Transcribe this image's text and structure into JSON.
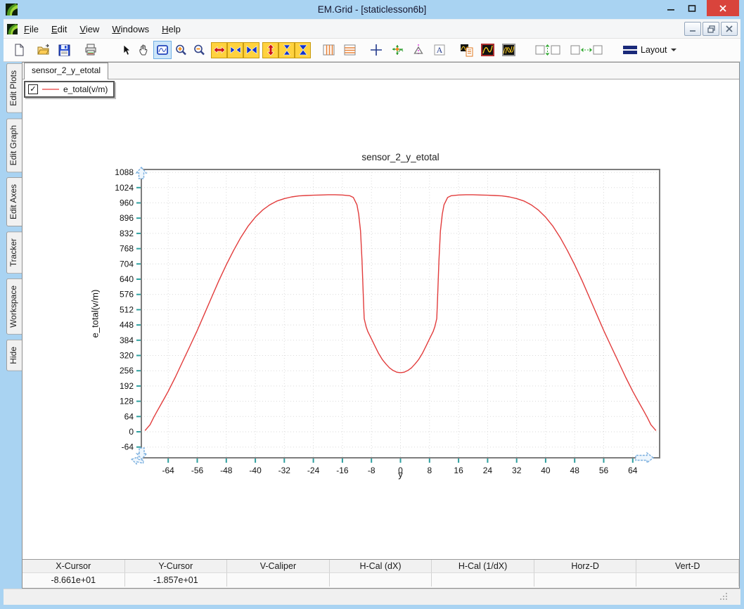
{
  "window": {
    "title": "EM.Grid - [staticlesson6b]",
    "controls": [
      "minimize",
      "maximize",
      "close"
    ]
  },
  "menu": {
    "items": [
      {
        "first": "F",
        "rest": "ile"
      },
      {
        "first": "E",
        "rest": "dit"
      },
      {
        "first": "V",
        "rest": "iew"
      },
      {
        "first": "W",
        "rest": "indows"
      },
      {
        "first": "H",
        "rest": "elp"
      }
    ]
  },
  "toolbar": {
    "layout_label": "Layout",
    "active_tool": "zoom-box",
    "icons": [
      "new-document",
      "open",
      "save",
      "print",
      "select-pointer",
      "pan-hand",
      "zoom-box",
      "zoom-in",
      "zoom-out",
      "expand-x",
      "shrink-x",
      "fit-x",
      "expand-y",
      "shrink-y",
      "fit-y",
      "vertical-gridlines",
      "horizontal-gridlines",
      "crosshair-cursor",
      "tracker-cursor",
      "caliper",
      "text-annotation",
      "plot-properties",
      "single-plot",
      "multi-plot",
      "align-vertical",
      "align-horizontal",
      "layout-menu"
    ]
  },
  "sidebar": {
    "tabs": [
      "Edit Plots",
      "Edit Graph",
      "Edit Axes",
      "Tracker",
      "Workspace",
      "Hide"
    ]
  },
  "doc": {
    "tab": "sensor_2_y_etotal"
  },
  "legend": {
    "checked": true,
    "check_glyph": "✓",
    "label": "e_total(v/m)",
    "line_color": "#f08585"
  },
  "statusbar": {
    "cols": [
      {
        "label": "X-Cursor",
        "value": "-8.661e+01"
      },
      {
        "label": "Y-Cursor",
        "value": "-1.857e+01"
      },
      {
        "label": "V-Caliper",
        "value": ""
      },
      {
        "label": "H-Cal (dX)",
        "value": ""
      },
      {
        "label": "H-Cal (1/dX)",
        "value": ""
      },
      {
        "label": "Horz-D",
        "value": ""
      },
      {
        "label": "Vert-D",
        "value": ""
      }
    ]
  },
  "colors": {
    "frame_blue": "#a9d3f2",
    "close_red": "#d9443c",
    "curve_red": "#e23c3c",
    "tick_teal": "#2f9f9f",
    "handle_blue": "#79aede"
  },
  "chart_data": {
    "type": "line",
    "title": "sensor_2_y_etotal",
    "xlabel": "y",
    "ylabel": "e_total(v/m)",
    "xlim": [
      -71.4,
      71.4
    ],
    "ylim": [
      -109,
      1100
    ],
    "x_ticks": [
      -64,
      -56,
      -48,
      -40,
      -32,
      -24,
      -16,
      -8,
      0,
      8,
      16,
      24,
      32,
      40,
      48,
      56,
      64
    ],
    "y_ticks": [
      -64,
      0,
      64,
      128,
      192,
      256,
      320,
      384,
      448,
      512,
      576,
      640,
      704,
      768,
      832,
      896,
      960,
      1024,
      1088
    ],
    "grid": true,
    "legend_position": "top-left-overlay",
    "series": [
      {
        "name": "e_total(v/m)",
        "color": "#e23c3c",
        "points": [
          [
            -70.4,
            5
          ],
          [
            -69,
            30
          ],
          [
            -68,
            60
          ],
          [
            -67,
            88
          ],
          [
            -66,
            115
          ],
          [
            -65,
            142
          ],
          [
            -64,
            170
          ],
          [
            -62,
            230
          ],
          [
            -60,
            295
          ],
          [
            -58,
            360
          ],
          [
            -56,
            425
          ],
          [
            -54,
            495
          ],
          [
            -52,
            565
          ],
          [
            -50,
            635
          ],
          [
            -48,
            700
          ],
          [
            -46,
            760
          ],
          [
            -44,
            815
          ],
          [
            -42,
            862
          ],
          [
            -40,
            900
          ],
          [
            -38,
            930
          ],
          [
            -36,
            952
          ],
          [
            -34,
            968
          ],
          [
            -32,
            978
          ],
          [
            -30,
            985
          ],
          [
            -28,
            989
          ],
          [
            -26,
            991
          ],
          [
            -24,
            992
          ],
          [
            -22,
            993
          ],
          [
            -20,
            994
          ],
          [
            -18,
            994
          ],
          [
            -16,
            993
          ],
          [
            -14,
            990
          ],
          [
            -13,
            983
          ],
          [
            -12,
            952
          ],
          [
            -11.5,
            912
          ],
          [
            -11,
            842
          ],
          [
            -10.6,
            718
          ],
          [
            -10.2,
            548
          ],
          [
            -10,
            475
          ],
          [
            -9.5,
            442
          ],
          [
            -9,
            420
          ],
          [
            -8,
            390
          ],
          [
            -7,
            358
          ],
          [
            -6,
            328
          ],
          [
            -5,
            303
          ],
          [
            -4,
            284
          ],
          [
            -3,
            268
          ],
          [
            -2,
            257
          ],
          [
            -1,
            250
          ],
          [
            0,
            248
          ],
          [
            1,
            250
          ],
          [
            2,
            257
          ],
          [
            3,
            268
          ],
          [
            4,
            284
          ],
          [
            5,
            303
          ],
          [
            6,
            328
          ],
          [
            7,
            358
          ],
          [
            8,
            390
          ],
          [
            9,
            420
          ],
          [
            9.5,
            442
          ],
          [
            10,
            475
          ],
          [
            10.2,
            548
          ],
          [
            10.6,
            718
          ],
          [
            11,
            842
          ],
          [
            11.5,
            912
          ],
          [
            12,
            952
          ],
          [
            13,
            983
          ],
          [
            14,
            990
          ],
          [
            16,
            993
          ],
          [
            18,
            994
          ],
          [
            20,
            994
          ],
          [
            22,
            993
          ],
          [
            24,
            992
          ],
          [
            26,
            991
          ],
          [
            28,
            989
          ],
          [
            30,
            985
          ],
          [
            32,
            978
          ],
          [
            34,
            968
          ],
          [
            36,
            952
          ],
          [
            38,
            930
          ],
          [
            40,
            900
          ],
          [
            42,
            862
          ],
          [
            44,
            815
          ],
          [
            46,
            760
          ],
          [
            48,
            700
          ],
          [
            50,
            635
          ],
          [
            52,
            565
          ],
          [
            54,
            495
          ],
          [
            56,
            425
          ],
          [
            58,
            360
          ],
          [
            60,
            295
          ],
          [
            62,
            230
          ],
          [
            64,
            170
          ],
          [
            65,
            142
          ],
          [
            66,
            115
          ],
          [
            67,
            88
          ],
          [
            68,
            60
          ],
          [
            69,
            30
          ],
          [
            70.4,
            5
          ]
        ]
      }
    ]
  }
}
